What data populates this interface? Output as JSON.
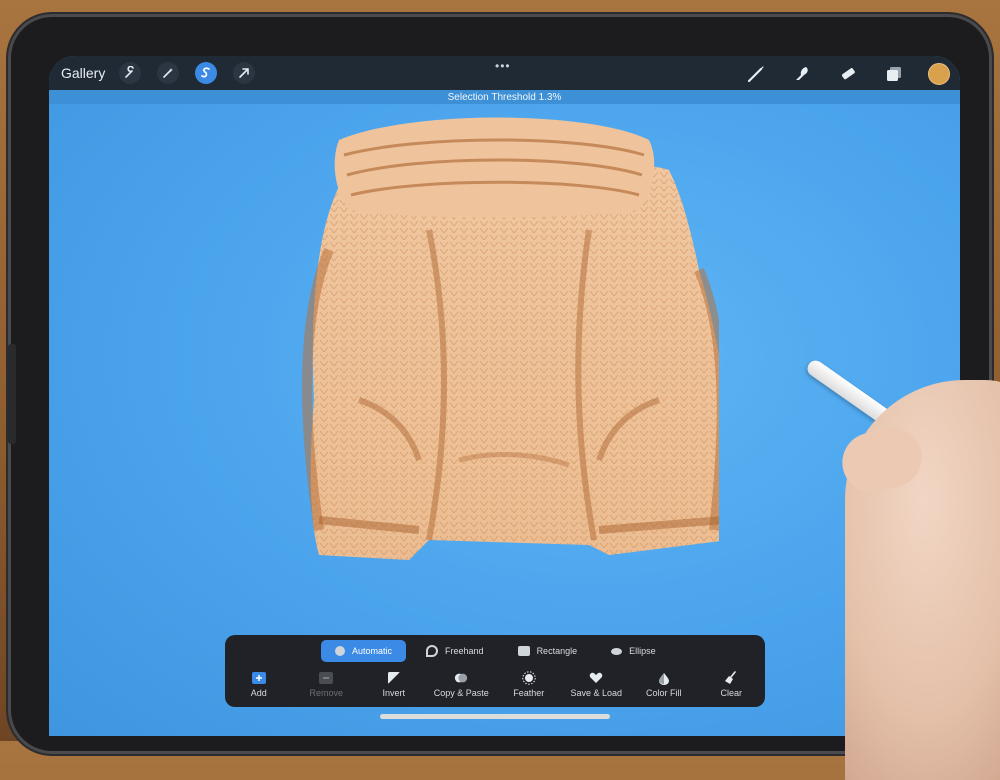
{
  "topbar": {
    "gallery_label": "Gallery",
    "more_dots": "•••",
    "tools_left": [
      "wrench-icon",
      "magic-wand-icon",
      "selection-icon",
      "transform-arrow-icon"
    ],
    "tools_right": [
      "brush-icon",
      "smudge-icon",
      "eraser-icon",
      "layers-icon"
    ],
    "color_swatch": "#d9a14b"
  },
  "status": {
    "threshold_text": "Selection Threshold 1.3%"
  },
  "selection_panel": {
    "modes": [
      {
        "label": "Automatic",
        "icon": "circle-icon",
        "active": true
      },
      {
        "label": "Freehand",
        "icon": "freehand-icon",
        "active": false
      },
      {
        "label": "Rectangle",
        "icon": "rectangle-icon",
        "active": false
      },
      {
        "label": "Ellipse",
        "icon": "ellipse-icon",
        "active": false
      }
    ],
    "actions": [
      {
        "label": "Add",
        "icon": "plus-icon",
        "enabled": true
      },
      {
        "label": "Remove",
        "icon": "minus-icon",
        "enabled": false
      },
      {
        "label": "Invert",
        "icon": "invert-icon",
        "enabled": true
      },
      {
        "label": "Copy & Paste",
        "icon": "copy-paste-icon",
        "enabled": true
      },
      {
        "label": "Feather",
        "icon": "feather-icon",
        "enabled": true
      },
      {
        "label": "Save & Load",
        "icon": "heart-icon",
        "enabled": true
      },
      {
        "label": "Color Fill",
        "icon": "color-fill-icon",
        "enabled": true
      },
      {
        "label": "Clear",
        "icon": "broom-icon",
        "enabled": true
      }
    ]
  },
  "colors": {
    "accent": "#3b8ae6",
    "canvas": "#4da9ef",
    "toolbar": "#1f2a35"
  }
}
